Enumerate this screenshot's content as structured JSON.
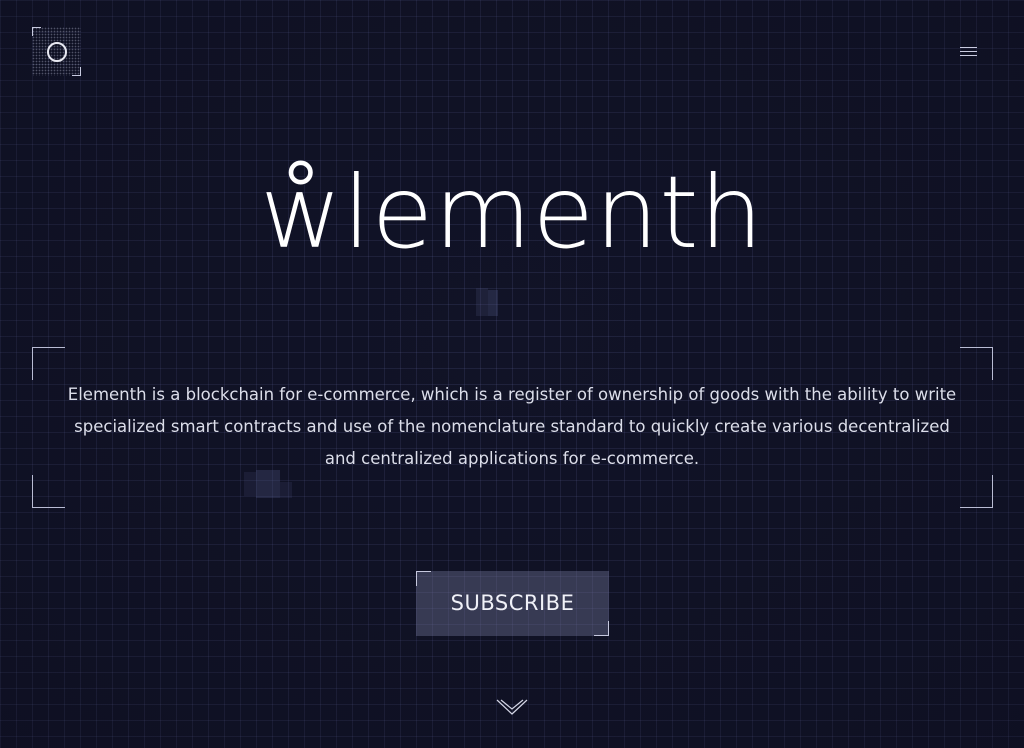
{
  "header": {
    "logo_icon": "circle-logo-icon",
    "menu_icon": "hamburger-menu-icon"
  },
  "hero": {
    "brand": "ẘlementh",
    "description": "Elementh is a blockchain for e-commerce, which is a register of ownership of goods with the ability to write specialized smart contracts and use of the nomenclature standard to quickly create various decentralized and centralized applications for e-commerce.",
    "cta_label": "SUBSCRIBE",
    "scroll_icon": "double-chevron-down-icon"
  },
  "colors": {
    "background": "#111327",
    "grid": "#2a2f55",
    "text": "#e6e7ef",
    "button_fill": "#4a4d6e"
  }
}
